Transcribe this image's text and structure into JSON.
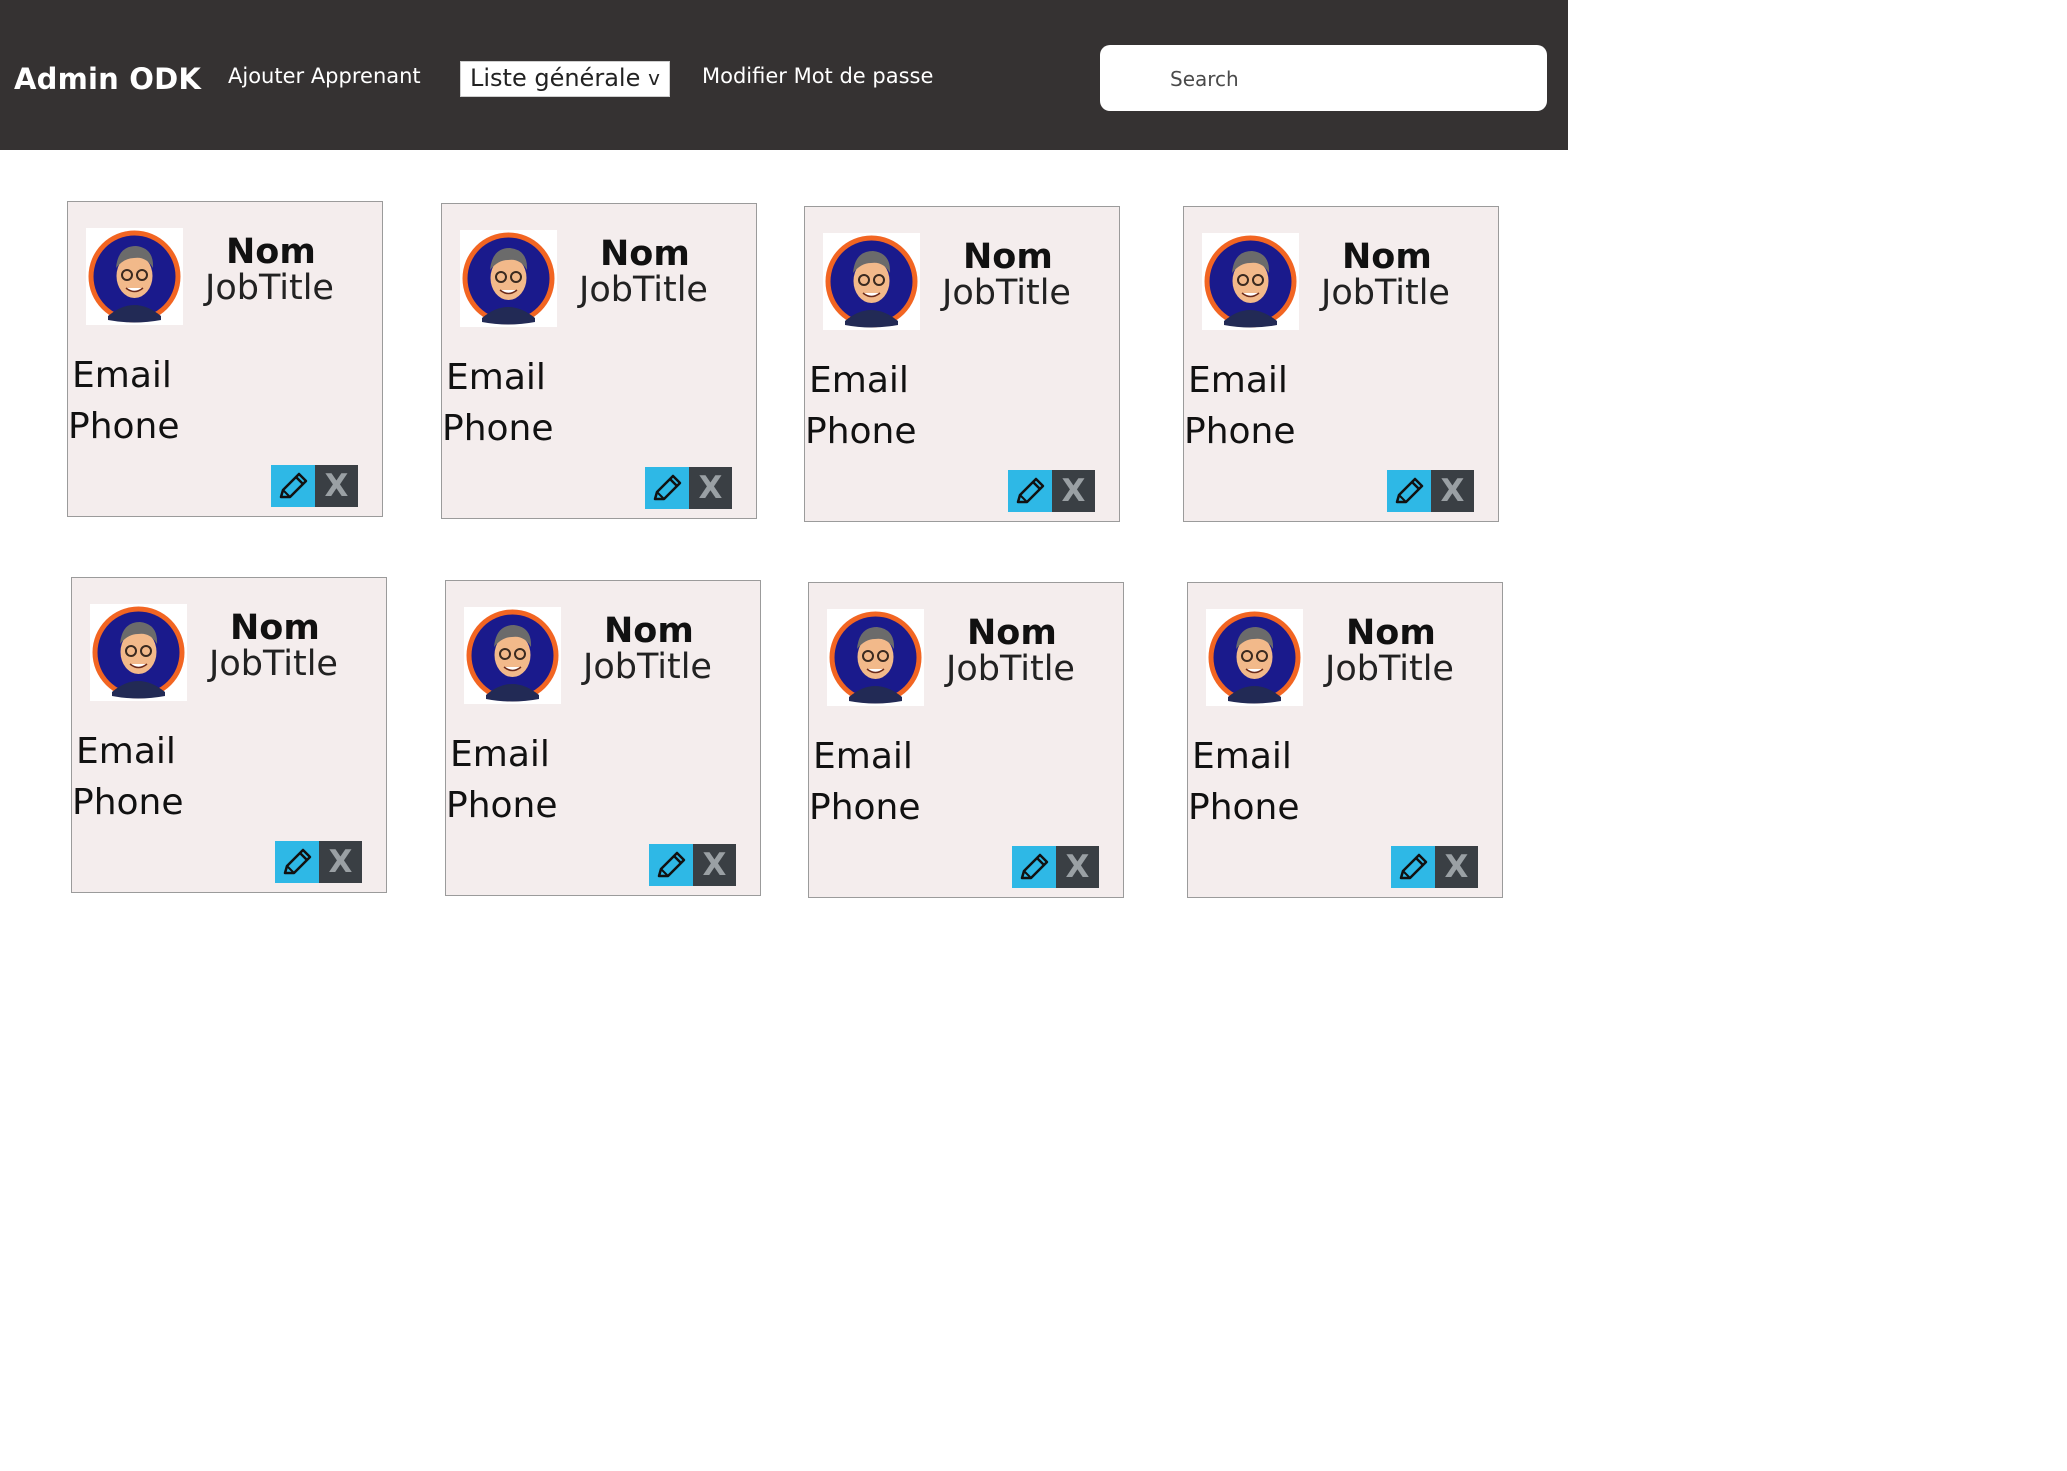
{
  "header": {
    "brand": "Admin ODK",
    "nav": {
      "add_learner": "Ajouter Apprenant",
      "list_select": "Liste générale",
      "change_password": "Modifier Mot de passe"
    },
    "search": {
      "placeholder": "Search"
    }
  },
  "colors": {
    "header_bg": "#353232",
    "card_bg": "#f4eded",
    "edit_button": "#2eb8e6",
    "delete_button": "#3a3f44",
    "avatar_ring": "#f26522",
    "avatar_fill": "#1a1a8c"
  },
  "icons": {
    "edit": "pencil-icon",
    "delete": "close-x-icon",
    "avatar": "user-avatar-icon",
    "dropdown": "chevron-down-icon"
  },
  "cards": [
    {
      "name": "Nom",
      "job_title": "JobTitle",
      "email": "Email",
      "phone": "Phone",
      "delete_label": "X"
    },
    {
      "name": "Nom",
      "job_title": "JobTitle",
      "email": "Email",
      "phone": "Phone",
      "delete_label": "X"
    },
    {
      "name": "Nom",
      "job_title": "JobTitle",
      "email": "Email",
      "phone": "Phone",
      "delete_label": "X"
    },
    {
      "name": "Nom",
      "job_title": "JobTitle",
      "email": "Email",
      "phone": "Phone",
      "delete_label": "X"
    },
    {
      "name": "Nom",
      "job_title": "JobTitle",
      "email": "Email",
      "phone": "Phone",
      "delete_label": "X"
    },
    {
      "name": "Nom",
      "job_title": "JobTitle",
      "email": "Email",
      "phone": "Phone",
      "delete_label": "X"
    },
    {
      "name": "Nom",
      "job_title": "JobTitle",
      "email": "Email",
      "phone": "Phone",
      "delete_label": "X"
    },
    {
      "name": "Nom",
      "job_title": "JobTitle",
      "email": "Email",
      "phone": "Phone",
      "delete_label": "X"
    }
  ]
}
